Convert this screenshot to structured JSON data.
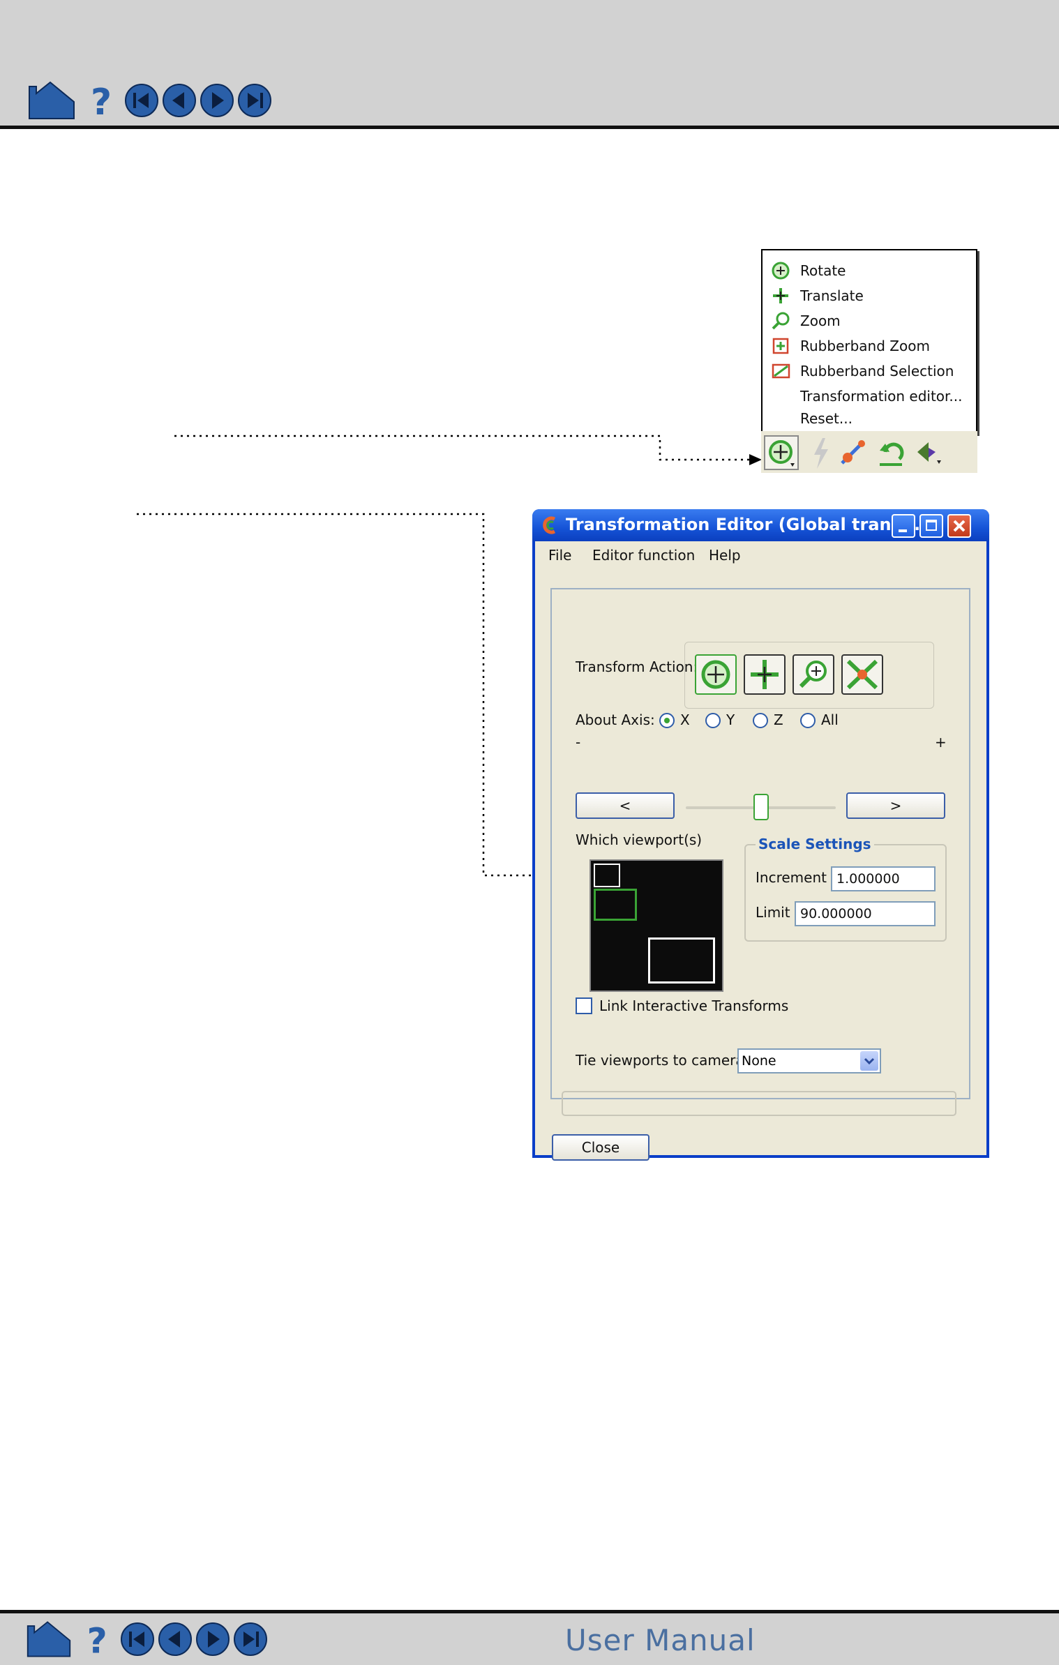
{
  "footer": {
    "title": "User Manual"
  },
  "popup_menu": {
    "items": [
      {
        "label": "Rotate",
        "icon": "rotate-icon"
      },
      {
        "label": "Translate",
        "icon": "translate-icon"
      },
      {
        "label": "Zoom",
        "icon": "zoom-icon"
      },
      {
        "label": "Rubberband Zoom",
        "icon": "rubberband-zoom-icon"
      },
      {
        "label": "Rubberband Selection",
        "icon": "rubberband-selection-icon"
      },
      {
        "label": "Transformation editor...",
        "icon": ""
      },
      {
        "label": "Reset...",
        "icon": ""
      }
    ]
  },
  "dialog": {
    "title": "Transformation Editor (Global trans...",
    "menu": {
      "file": "File",
      "editor_function": "Editor function",
      "help": "Help"
    },
    "transform_action_label": "Transform Action:",
    "about_axis_label": "About Axis:",
    "axes": [
      {
        "label": "X",
        "selected": true
      },
      {
        "label": "Y",
        "selected": false
      },
      {
        "label": "Z",
        "selected": false
      },
      {
        "label": "All",
        "selected": false
      }
    ],
    "minus_label": "-",
    "plus_label": "+",
    "decrement_button": "<",
    "increment_button": ">",
    "slider_level": 0.5,
    "which_viewports_label": "Which viewport(s)",
    "scale_settings": {
      "title": "Scale Settings",
      "increment_label": "Increment",
      "increment_value": "1.000000",
      "limit_label": "Limit",
      "limit_value": "90.000000"
    },
    "link_transforms_label": "Link Interactive Transforms",
    "link_transforms_checked": false,
    "tie_viewports_label": "Tie viewports to camera",
    "tie_viewports_value": "None",
    "close_button": "Close"
  },
  "colors": {
    "accent_green": "#3aa335",
    "title_blue": "#1553d6",
    "brand_blue": "#2a5fa8"
  }
}
